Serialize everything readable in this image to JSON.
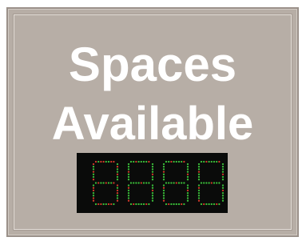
{
  "sign": {
    "line1": "Spaces",
    "line2": "Available"
  },
  "display": {
    "digit_count": 4,
    "colors": {
      "background": "#0a0b0a",
      "led_green": "#3bbf3a",
      "led_red": "#d23b2a"
    }
  }
}
